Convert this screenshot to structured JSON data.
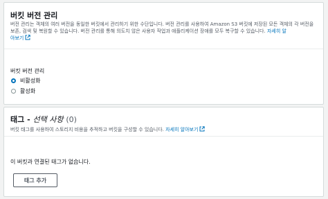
{
  "versioning": {
    "title": "버킷 버전 관리",
    "desc_line1": "버전 관리는 객체의 여러 버전을 동일한 버킷에서 관리하기 위한 수단입니다. 버전 관리를 사용하여 Amazon S3 버킷에 저장된 모든 객체의 각",
    "desc_line2": "버전을 보존, 검색 및 복원할 수 있습니다. 버전 관리를 통해 의도치 않은 사용자 작업과 애플리케이션 장애를 모두 복구할 수 있습니다.",
    "learn_more_part1": "자세히 알",
    "learn_more_part2": "아보기",
    "field_label": "버킷 버전 관리",
    "options": [
      "비활성화",
      "활성화"
    ],
    "selected": "비활성화"
  },
  "tags": {
    "title": "태그",
    "title_sep": " - ",
    "title_optional": "선택 사항",
    "count": "(0)",
    "desc": "버킷 태그를 사용하여 스토리지 비용을 추적하고 버킷을 구성할 수 있습니다.",
    "learn_more": "자세히 알아보기",
    "empty_message": "이 버킷과 연결된 태그가 없습니다.",
    "add_button": "태그 추가"
  },
  "colors": {
    "link": "#0073bb",
    "border": "#d5dbdb",
    "text_secondary": "#545b64"
  }
}
